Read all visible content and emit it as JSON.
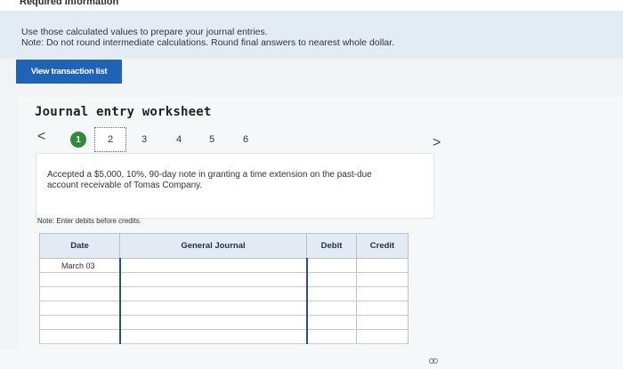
{
  "header": {
    "title": "Required information"
  },
  "instructions": {
    "line1": "Use those calculated values to prepare your journal entries.",
    "line2": "Note: Do not round intermediate calculations. Round final answers to nearest whole dollar."
  },
  "buttons": {
    "view_transactions": "View transaction list"
  },
  "worksheet": {
    "title": "Journal entry worksheet",
    "prev": "<",
    "next": ">",
    "steps": [
      "1",
      "2",
      "3",
      "4",
      "5",
      "6"
    ],
    "description": "Accepted a $5,000, 10%, 90-day note in granting a time extension on the past-due account receivable of Tomas Company.",
    "note": "Note: Enter debits before credits."
  },
  "journal": {
    "columns": {
      "date": "Date",
      "general_journal": "General Journal",
      "debit": "Debit",
      "credit": "Credit"
    },
    "rows": [
      {
        "date": "March 03",
        "account": "",
        "debit": "",
        "credit": ""
      },
      {
        "date": "",
        "account": "",
        "debit": "",
        "credit": ""
      },
      {
        "date": "",
        "account": "",
        "debit": "",
        "credit": ""
      },
      {
        "date": "",
        "account": "",
        "debit": "",
        "credit": ""
      },
      {
        "date": "",
        "account": "",
        "debit": "",
        "credit": ""
      },
      {
        "date": "",
        "account": "",
        "debit": "",
        "credit": ""
      }
    ]
  }
}
